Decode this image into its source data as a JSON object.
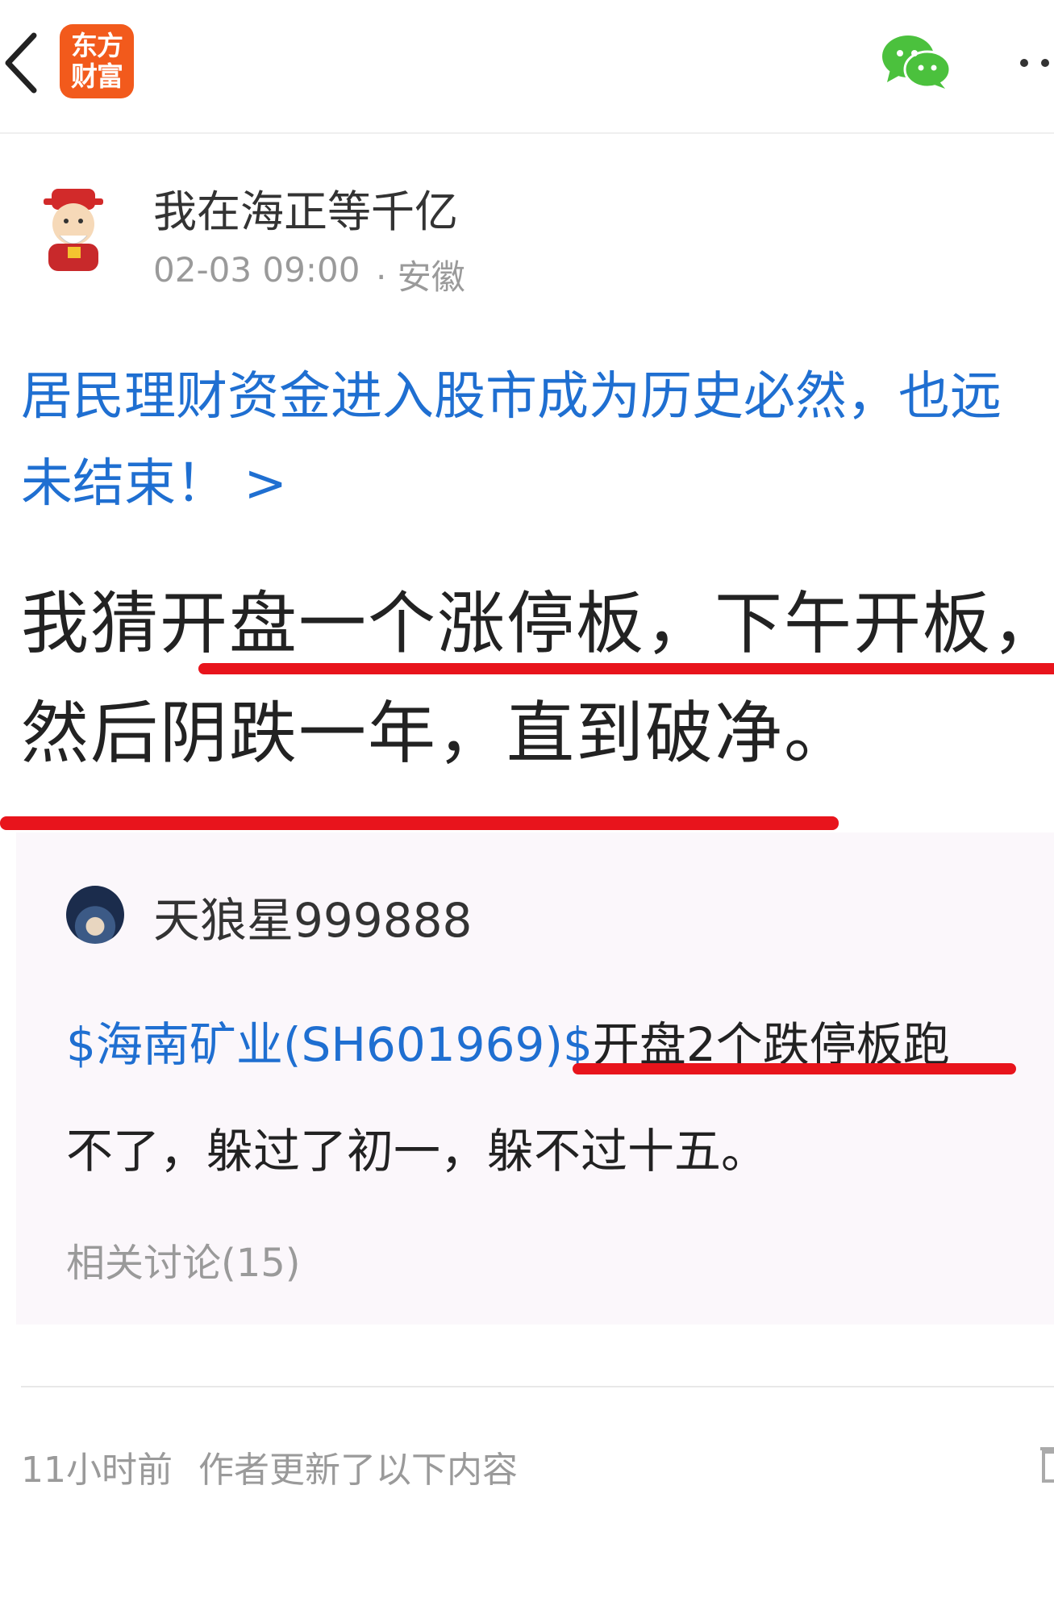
{
  "header": {
    "logo_line1": "东方",
    "logo_line2": "财富",
    "back_icon": "back-arrow-icon",
    "share_icon": "wechat-icon",
    "more_icon": "more-dots-icon"
  },
  "post": {
    "author": "我在海正等千亿",
    "time": "02-03 09:00",
    "location": "· 安徽",
    "linked_article_line1": "居民理财资金进入股市成为历史必然，也远",
    "linked_article_line2": "未结束！ >",
    "body_line1": "我猜开盘一个涨停板，下午开板，",
    "body_line2": "然后阴跌一年，直到破净。"
  },
  "quote": {
    "user": "天狼星999888",
    "stock_link": "$海南矿业(SH601969)$",
    "text_line1": "开盘2个跌停板跑",
    "text_line2": "不了，躲过了初一，躲不过十五。",
    "related": "相关讨论(15)"
  },
  "footer": {
    "update_time": "11小时前",
    "update_text": "作者更新了以下内容"
  },
  "colors": {
    "link": "#1f6fd1",
    "logo": "#f25a1c",
    "annotation_red": "#e8141c",
    "wechat_green": "#4bc13d"
  }
}
